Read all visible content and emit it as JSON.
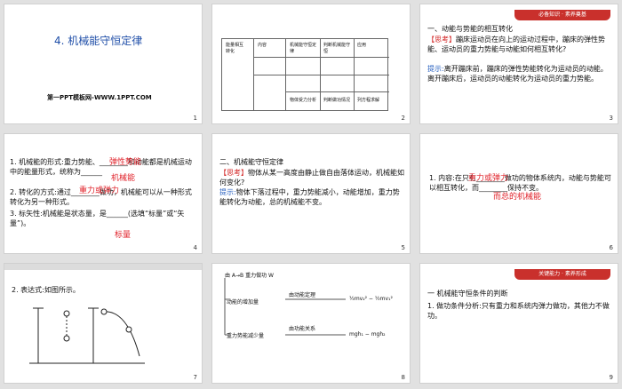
{
  "slides": [
    {
      "num": "1",
      "title": "4. 机械能守恒定律",
      "footer": "第一PPT模板网-WWW.1PPT.COM"
    },
    {
      "num": "2",
      "table": {
        "h1": "能量相互",
        "h2": "转化",
        "c1": "内容",
        "c2": "机械能守恒定律",
        "c3": "判断机械能守恒",
        "c4": "应用",
        "r1": "物体受力分析",
        "r2": "判断做功情况",
        "r3": "列方程求解"
      }
    },
    {
      "num": "3",
      "banner": "必备知识 · 素养奠基",
      "heading": "一、动能与势能的相互转化",
      "think_tag": "【思考】",
      "think": "蹦床运动员在向上的运动过程中，蹦床的弹性势能、运动员的重力势能与动能如何相互转化?",
      "hint_tag": "提示:",
      "hint": "离开蹦床前，蹦床的弹性势能转化为运动员的动能。离开蹦床后，运动员的动能转化为运动员的重力势能。"
    },
    {
      "num": "4",
      "l1": "1. 机械能的形式:重力势能、",
      "l1b": "和动能都是机械运动中的能量形式，统称为",
      "l2": "2. 转化的方式:通过",
      "l2b": "做功，机械能可以从一种形式转化为另一种形式。",
      "l3": "3. 标矢性:机械能是状态量，是",
      "l3b": "(选填“标量”或“矢量”)。",
      "a1": "弹性势能",
      "a2": "机械能",
      "a3": "重力或弹力",
      "a4": "标量"
    },
    {
      "num": "5",
      "heading": "二、机械能守恒定律",
      "think_tag": "【思考】",
      "think": "物体从某一高度由静止做自由落体运动，机械能如何变化?",
      "hint_tag": "提示:",
      "hint": "物体下落过程中，重力势能减小，动能增加，重力势能转化为动能，总的机械能不变。"
    },
    {
      "num": "6",
      "l1": "1. 内容:在只有",
      "l1b": "做功的物体系统内，动能与势能可以相互转化，而",
      "l1c": "保持不变。",
      "a1": "重力或弹力",
      "a2": "而总的机械能"
    },
    {
      "num": "7",
      "l1": "2. 表达式:如图所示。"
    },
    {
      "num": "8",
      "f1": "由 A→B 重力做功 W",
      "f2": "动能的增加量",
      "f3": "由动能定理",
      "f4": "重力势能减少量",
      "f5": "由功能关系",
      "e1": "½mv₂² − ½mv₁²",
      "e2": "mgh₁ − mgh₂"
    },
    {
      "num": "9",
      "banner": "关键能力 · 素养形成",
      "heading": "一  机械能守恒条件的判断",
      "l1": "1. 做功条件分析:只有重力和系统内弹力做功，其他力不做功。"
    }
  ]
}
